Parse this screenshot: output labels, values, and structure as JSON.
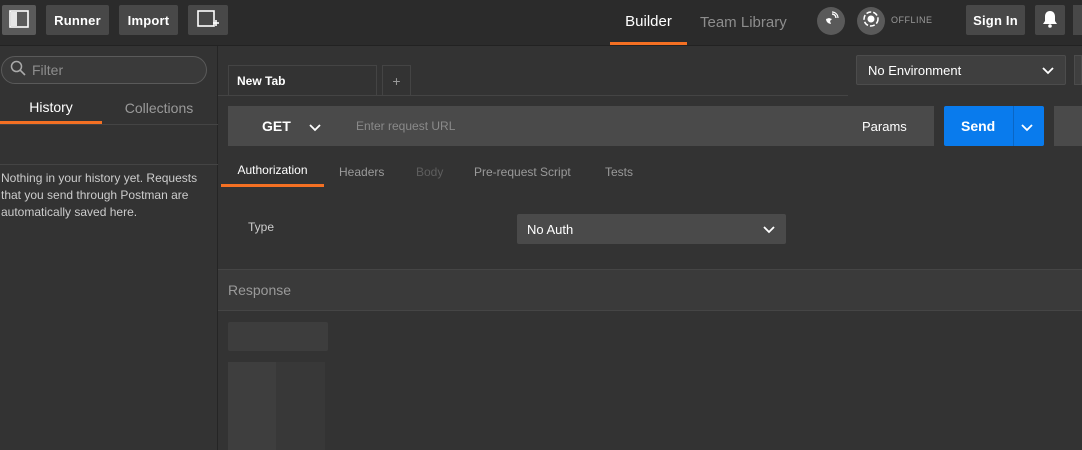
{
  "topbar": {
    "runner_label": "Runner",
    "import_label": "Import",
    "nav_tabs": [
      {
        "label": "Builder",
        "active": true
      },
      {
        "label": "Team Library",
        "active": false
      }
    ],
    "offline_label": "OFFLINE",
    "signin_label": "Sign In",
    "icons": [
      "sidebar-toggle-icon",
      "new-window-icon",
      "sync-satellite-icon",
      "offline-status-icon",
      "bell-icon"
    ]
  },
  "sidebar": {
    "filter_placeholder": "Filter",
    "tabs": [
      {
        "label": "History",
        "active": true
      },
      {
        "label": "Collections",
        "active": false
      }
    ],
    "empty_message": "Nothing in your history yet. Requests that you send through Postman are automatically saved here."
  },
  "main": {
    "request_tab_label": "New Tab",
    "add_tab_label": "+",
    "environment": "No Environment",
    "method": "GET",
    "url_placeholder": "Enter request URL",
    "params_label": "Params",
    "send_label": "Send",
    "subtabs": [
      {
        "label": "Authorization",
        "active": true
      },
      {
        "label": "Headers",
        "active": false
      },
      {
        "label": "Body",
        "active": false,
        "disabled": true
      },
      {
        "label": "Pre-request Script",
        "active": false
      },
      {
        "label": "Tests",
        "active": false
      }
    ],
    "auth_type_label": "Type",
    "auth_type_value": "No Auth",
    "response_label": "Response"
  },
  "colors": {
    "accent": "#f47023",
    "send_blue": "#097bed",
    "background": "#333333",
    "topbar": "#2b2b2b"
  }
}
